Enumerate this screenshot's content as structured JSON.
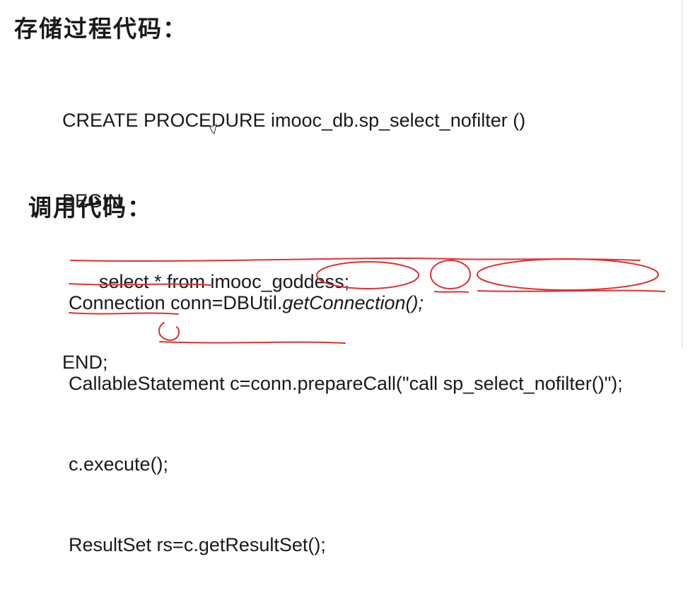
{
  "heading_procedure": "存储过程代码：",
  "procedure_code": [
    "CREATE PROCEDURE imooc_db.sp_select_nofilter ()",
    "BEGIN",
    "select * from imooc_goddess;",
    "END;"
  ],
  "heading_call": "调用代码：",
  "call_code": {
    "line1_plain": "Connection conn=DBUtil.",
    "line1_italic": "getConnection();",
    "line2": "CallableStatement c=conn.prepareCall(\"call sp_select_nofilter()\");",
    "line3": "c.execute();",
    "line4": "ResultSet rs=c.getResultSet();"
  },
  "annotation_color": "#e03030"
}
